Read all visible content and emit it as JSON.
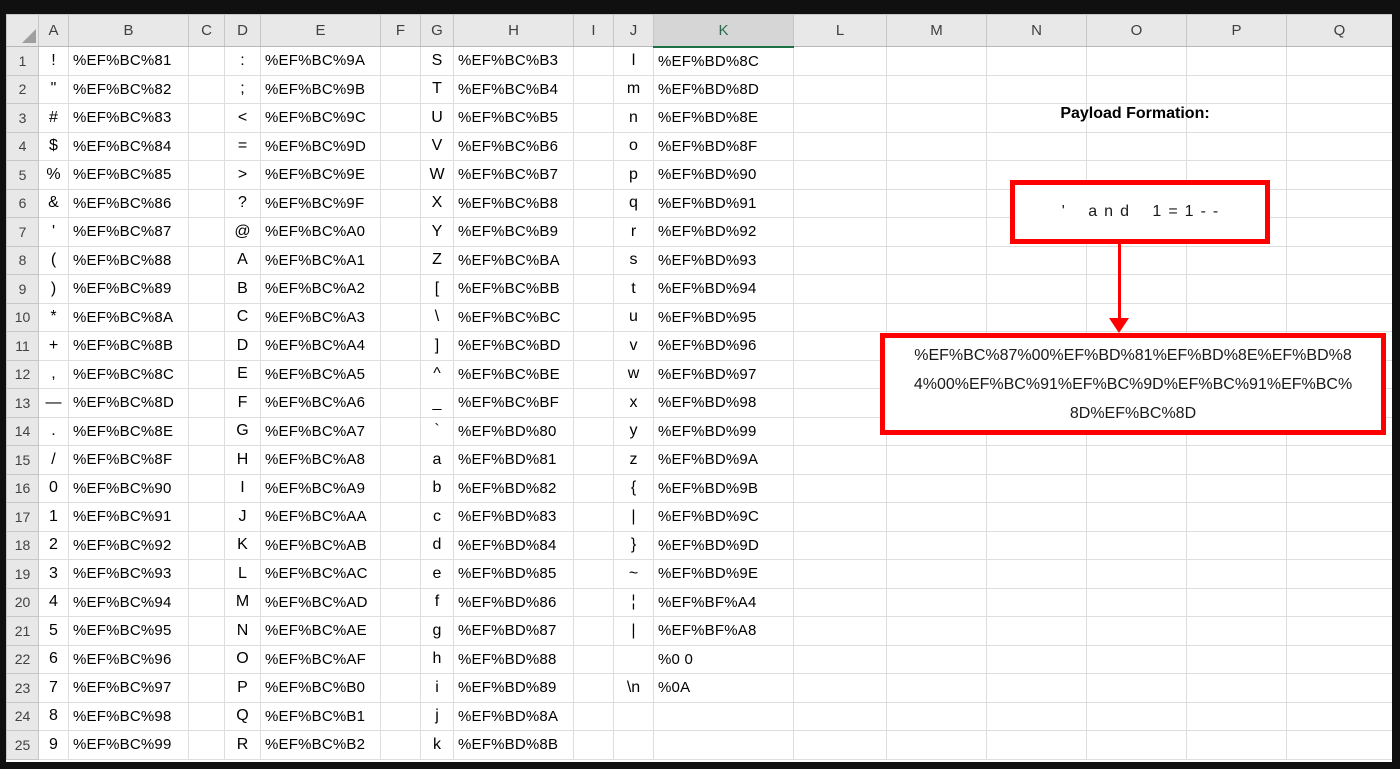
{
  "sheet": {
    "column_headers": [
      "A",
      "B",
      "C",
      "D",
      "E",
      "F",
      "G",
      "H",
      "I",
      "J",
      "K",
      "L",
      "M",
      "N",
      "O",
      "P",
      "Q"
    ],
    "selected_column_header": "K",
    "rows": [
      {
        "n": "1",
        "cells": {
          "A": "!",
          "B": "%EF%BC%81",
          "D": ":",
          "E": "%EF%BC%9A",
          "G": "S",
          "H": "%EF%BC%B3",
          "J": "l",
          "K": "%EF%BD%8C"
        }
      },
      {
        "n": "2",
        "cells": {
          "A": "\"",
          "B": "%EF%BC%82",
          "D": ";",
          "E": "%EF%BC%9B",
          "G": "T",
          "H": "%EF%BC%B4",
          "J": "m",
          "K": "%EF%BD%8D"
        }
      },
      {
        "n": "3",
        "cells": {
          "A": "#",
          "B": "%EF%BC%83",
          "D": "<",
          "E": "%EF%BC%9C",
          "G": "U",
          "H": "%EF%BC%B5",
          "J": "n",
          "K": "%EF%BD%8E"
        }
      },
      {
        "n": "4",
        "cells": {
          "A": "$",
          "B": "%EF%BC%84",
          "D": "=",
          "E": "%EF%BC%9D",
          "G": "V",
          "H": "%EF%BC%B6",
          "J": "o",
          "K": "%EF%BD%8F"
        }
      },
      {
        "n": "5",
        "cells": {
          "A": "%",
          "B": "%EF%BC%85",
          "D": ">",
          "E": "%EF%BC%9E",
          "G": "W",
          "H": "%EF%BC%B7",
          "J": "p",
          "K": "%EF%BD%90"
        }
      },
      {
        "n": "6",
        "cells": {
          "A": "&",
          "B": "%EF%BC%86",
          "D": "?",
          "E": "%EF%BC%9F",
          "G": "X",
          "H": "%EF%BC%B8",
          "J": "q",
          "K": "%EF%BD%91"
        }
      },
      {
        "n": "7",
        "cells": {
          "A": "'",
          "B": "%EF%BC%87",
          "D": "@",
          "E": "%EF%BC%A0",
          "G": "Y",
          "H": "%EF%BC%B9",
          "J": "r",
          "K": "%EF%BD%92"
        }
      },
      {
        "n": "8",
        "cells": {
          "A": "(",
          "B": "%EF%BC%88",
          "D": "A",
          "E": "%EF%BC%A1",
          "G": "Z",
          "H": "%EF%BC%BA",
          "J": "s",
          "K": "%EF%BD%93"
        }
      },
      {
        "n": "9",
        "cells": {
          "A": ")",
          "B": "%EF%BC%89",
          "D": "B",
          "E": "%EF%BC%A2",
          "G": "[",
          "H": "%EF%BC%BB",
          "J": "t",
          "K": "%EF%BD%94"
        }
      },
      {
        "n": "10",
        "cells": {
          "A": "*",
          "B": "%EF%BC%8A",
          "D": "C",
          "E": "%EF%BC%A3",
          "G": "\\",
          "H": "%EF%BC%BC",
          "J": "u",
          "K": "%EF%BD%95"
        }
      },
      {
        "n": "11",
        "cells": {
          "A": "+",
          "B": "%EF%BC%8B",
          "D": "D",
          "E": "%EF%BC%A4",
          "G": "]",
          "H": "%EF%BC%BD",
          "J": "v",
          "K": "%EF%BD%96"
        }
      },
      {
        "n": "12",
        "cells": {
          "A": ",",
          "B": "%EF%BC%8C",
          "D": "E",
          "E": "%EF%BC%A5",
          "G": "^",
          "H": "%EF%BC%BE",
          "J": "w",
          "K": "%EF%BD%97"
        }
      },
      {
        "n": "13",
        "cells": {
          "A": "—",
          "B": "%EF%BC%8D",
          "D": "F",
          "E": "%EF%BC%A6",
          "G": "_",
          "H": "%EF%BC%BF",
          "J": "x",
          "K": "%EF%BD%98"
        }
      },
      {
        "n": "14",
        "cells": {
          "A": ".",
          "B": "%EF%BC%8E",
          "D": "G",
          "E": "%EF%BC%A7",
          "G": "`",
          "H": "%EF%BD%80",
          "J": "y",
          "K": "%EF%BD%99"
        }
      },
      {
        "n": "15",
        "cells": {
          "A": "/",
          "B": "%EF%BC%8F",
          "D": "H",
          "E": "%EF%BC%A8",
          "G": "a",
          "H": "%EF%BD%81",
          "J": "z",
          "K": "%EF%BD%9A"
        }
      },
      {
        "n": "16",
        "cells": {
          "A": "0",
          "B": "%EF%BC%90",
          "D": "I",
          "E": "%EF%BC%A9",
          "G": "b",
          "H": "%EF%BD%82",
          "J": "{",
          "K": "%EF%BD%9B"
        }
      },
      {
        "n": "17",
        "cells": {
          "A": "1",
          "B": "%EF%BC%91",
          "D": "J",
          "E": "%EF%BC%AA",
          "G": "c",
          "H": "%EF%BD%83",
          "J": "|",
          "K": "%EF%BD%9C"
        }
      },
      {
        "n": "18",
        "cells": {
          "A": "2",
          "B": "%EF%BC%92",
          "D": "K",
          "E": "%EF%BC%AB",
          "G": "d",
          "H": "%EF%BD%84",
          "J": "}",
          "K": "%EF%BD%9D"
        }
      },
      {
        "n": "19",
        "cells": {
          "A": "3",
          "B": "%EF%BC%93",
          "D": "L",
          "E": "%EF%BC%AC",
          "G": "e",
          "H": "%EF%BD%85",
          "J": "~",
          "K": "%EF%BD%9E"
        }
      },
      {
        "n": "20",
        "cells": {
          "A": "4",
          "B": "%EF%BC%94",
          "D": "M",
          "E": "%EF%BC%AD",
          "G": "f",
          "H": "%EF%BD%86",
          "J": "¦",
          "K": "%EF%BF%A4"
        }
      },
      {
        "n": "21",
        "cells": {
          "A": "5",
          "B": "%EF%BC%95",
          "D": "N",
          "E": "%EF%BC%AE",
          "G": "g",
          "H": "%EF%BD%87",
          "J": "|",
          "K": "%EF%BF%A8"
        }
      },
      {
        "n": "22",
        "cells": {
          "A": "6",
          "B": "%EF%BC%96",
          "D": "O",
          "E": "%EF%BC%AF",
          "G": "h",
          "H": "%EF%BD%88",
          "K": "%0 0"
        }
      },
      {
        "n": "23",
        "cells": {
          "A": "7",
          "B": "%EF%BC%97",
          "D": "P",
          "E": "%EF%BC%B0",
          "G": "i",
          "H": "%EF%BD%89",
          "J": "\\n",
          "K": "%0A"
        }
      },
      {
        "n": "24",
        "cells": {
          "A": "8",
          "B": "%EF%BC%98",
          "D": "Q",
          "E": "%EF%BC%B1",
          "G": "j",
          "H": "%EF%BD%8A"
        }
      },
      {
        "n": "25",
        "cells": {
          "A": "9",
          "B": "%EF%BC%99",
          "D": "R",
          "E": "%EF%BC%B2",
          "G": "k",
          "H": "%EF%BD%8B"
        }
      }
    ]
  },
  "annotation": {
    "title": "Payload Formation:",
    "input_text": "' and 1=1--",
    "payload_lines": [
      "%EF%BC%87%00%EF%BD%81%EF%BD%8E%EF%BD%8",
      "4%00%EF%BC%91%EF%BC%9D%EF%BC%91%EF%BC%",
      "8D%EF%BC%8D"
    ],
    "payload_full": "%EF%BC%87%00%EF%BD%81%EF%BD%8E%EF%BD%84%00%EF%BC%91%EF%BC%9D%EF%BC%91%EF%BC%8D%EF%BC%8D"
  },
  "colors": {
    "accent_red": "#FF0000",
    "selected_header_green": "#1E7145",
    "header_bg": "#E8E8E8",
    "selected_header_bg": "#D6D6D6",
    "gridline": "#DEDEDE",
    "frame_black": "#101010"
  }
}
